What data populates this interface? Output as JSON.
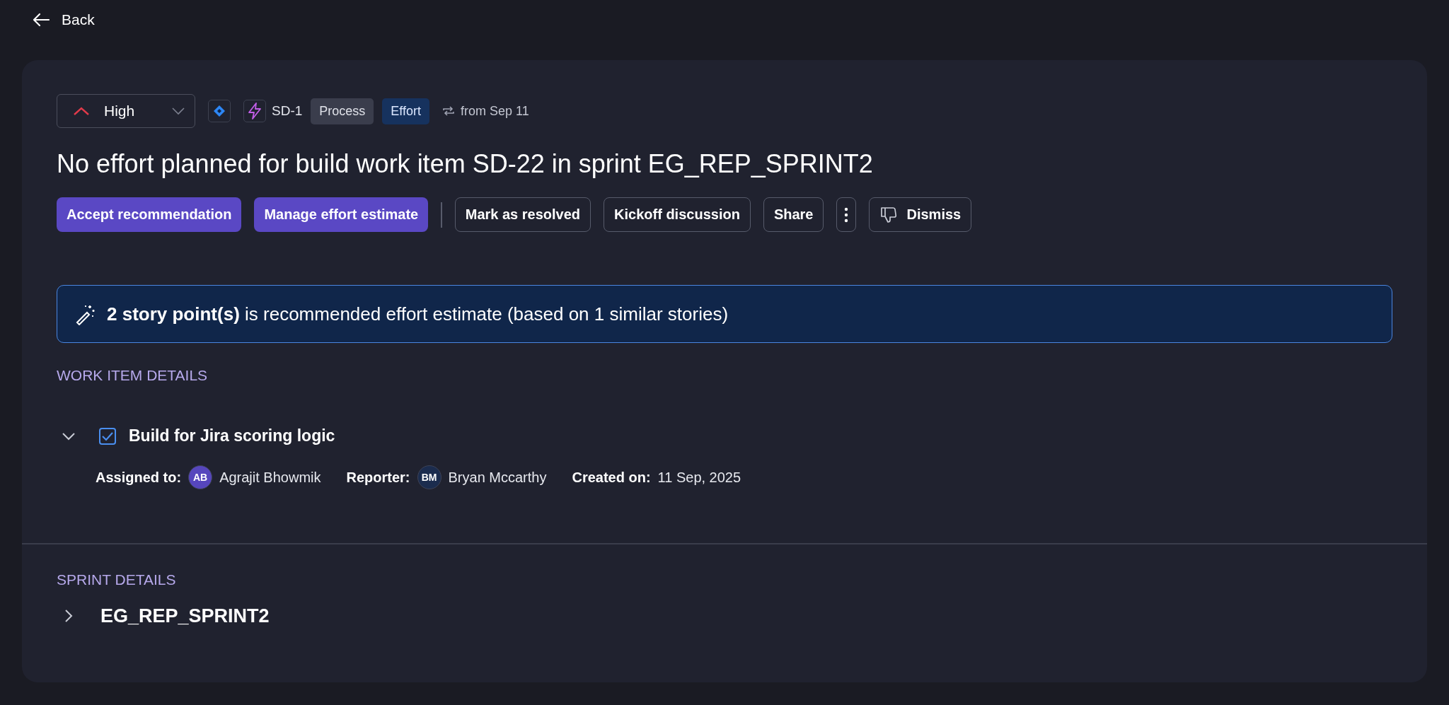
{
  "back": "Back",
  "priority": {
    "label": "High"
  },
  "tags": [
    {
      "kind": "plain",
      "label": "SD-1"
    },
    {
      "kind": "grey",
      "label": "Process"
    },
    {
      "kind": "blue",
      "label": "Effort"
    },
    {
      "kind": "since",
      "label": "from Sep 11"
    }
  ],
  "title": "No effort planned for build work item SD-22 in sprint EG_REP_SPRINT2",
  "actions": [
    {
      "kind": "primary",
      "label": "Accept recommendation"
    },
    {
      "kind": "primary",
      "label": "Manage effort estimate"
    },
    {
      "kind": "divider"
    },
    {
      "kind": "outline",
      "label": "Mark as resolved"
    },
    {
      "kind": "outline",
      "label": "Kickoff discussion"
    },
    {
      "kind": "outline",
      "label": "Share"
    },
    {
      "kind": "more"
    },
    {
      "kind": "dismiss",
      "label": "Dismiss"
    }
  ],
  "recommendation": "**2 story point(s)** is recommended effort estimate (based on 1 similar stories)",
  "work_item": {
    "section_title": "WORK ITEM DETAILS",
    "expanded": true,
    "checked": true,
    "title": "Build for Jira scoring logic",
    "meta": [
      {
        "label": "Assigned to:",
        "initials": "AB",
        "color": "#5646bd",
        "value": "Agrajit Bhowmik"
      },
      {
        "label": "Reporter:",
        "initials": "BM",
        "color": "#1b2c4e",
        "value": "Bryan Mccarthy"
      },
      {
        "label": "Created on:",
        "value": "11 Sep, 2025"
      }
    ]
  },
  "sprint": {
    "section_title": "SPRINT DETAILS",
    "expanded": false,
    "name": "EG_REP_SPRINT2"
  }
}
